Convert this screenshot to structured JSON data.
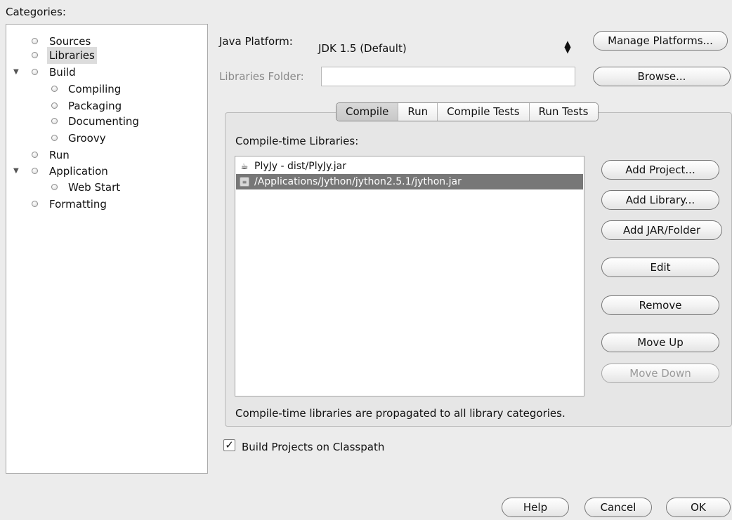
{
  "categories": {
    "title": "Categories:",
    "items": [
      {
        "label": "Sources"
      },
      {
        "label": "Libraries"
      },
      {
        "label": "Build"
      },
      {
        "label": "Compiling"
      },
      {
        "label": "Packaging"
      },
      {
        "label": "Documenting"
      },
      {
        "label": "Groovy"
      },
      {
        "label": "Run"
      },
      {
        "label": "Application"
      },
      {
        "label": "Web Start"
      },
      {
        "label": "Formatting"
      }
    ]
  },
  "java_platform": {
    "label": "Java Platform:",
    "value": "JDK 1.5 (Default)",
    "manage_button": "Manage Platforms..."
  },
  "libraries_folder": {
    "label": "Libraries Folder:",
    "value": "",
    "browse_button": "Browse..."
  },
  "tabs": [
    "Compile",
    "Run",
    "Compile Tests",
    "Run Tests"
  ],
  "compile": {
    "list_label": "Compile-time Libraries:",
    "items": [
      {
        "label": "PlyJy - dist/PlyJy.jar",
        "icon": "coffee-cup-icon"
      },
      {
        "label": "/Applications/Jython/jython2.5.1/jython.jar",
        "icon": "jar-icon"
      }
    ],
    "buttons": {
      "add_project": "Add Project...",
      "add_library": "Add Library...",
      "add_jar": "Add JAR/Folder",
      "edit": "Edit",
      "remove": "Remove",
      "move_up": "Move Up",
      "move_down": "Move Down"
    },
    "note": "Compile-time libraries are propagated to all library categories."
  },
  "build_on_classpath": {
    "label": "Build Projects on Classpath",
    "checked": true
  },
  "dialog_buttons": {
    "help": "Help",
    "cancel": "Cancel",
    "ok": "OK"
  }
}
